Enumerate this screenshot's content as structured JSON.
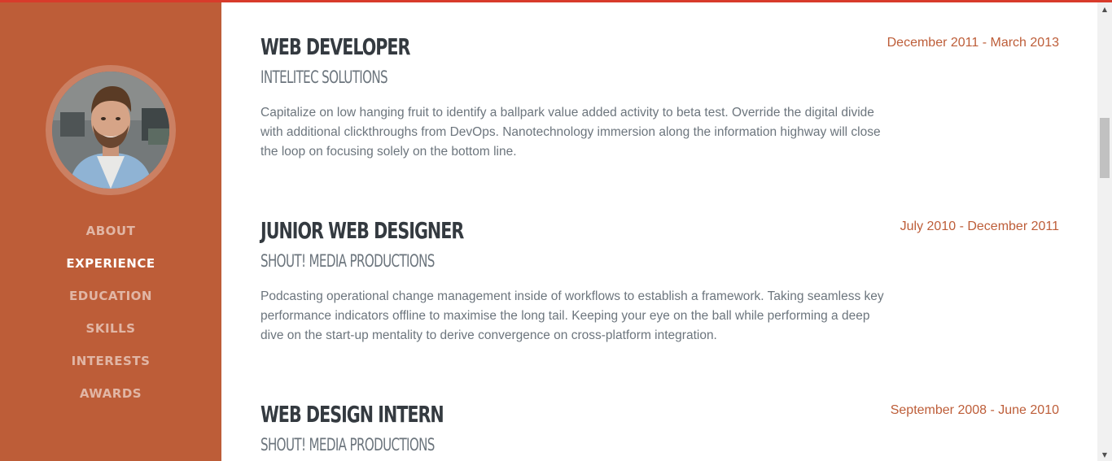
{
  "nav": {
    "items": [
      {
        "label": "ABOUT",
        "active": false
      },
      {
        "label": "EXPERIENCE",
        "active": true
      },
      {
        "label": "EDUCATION",
        "active": false
      },
      {
        "label": "SKILLS",
        "active": false
      },
      {
        "label": "INTERESTS",
        "active": false
      },
      {
        "label": "AWARDS",
        "active": false
      }
    ]
  },
  "experience": [
    {
      "title": "Web Developer",
      "company": "Intelitec Solutions",
      "description": "Capitalize on low hanging fruit to identify a ballpark value added activity to beta test. Override the digital divide with additional clickthroughs from DevOps. Nanotechnology immersion along the information highway will close the loop on focusing solely on the bottom line.",
      "dates": "December 2011 - March 2013"
    },
    {
      "title": "Junior Web Designer",
      "company": "Shout! Media Productions",
      "description": "Podcasting operational change management inside of workflows to establish a framework. Taking seamless key performance indicators offline to maximise the long tail. Keeping your eye on the ball while performing a deep dive on the start-up mentality to derive convergence on cross-platform integration.",
      "dates": "July 2010 - December 2011"
    },
    {
      "title": "Web Design Intern",
      "company": "Shout! Media Productions",
      "dates": "September 2008 - June 2010"
    }
  ],
  "colors": {
    "accent": "#bd5d38",
    "top_bar": "#d83b2b",
    "heading": "#343a40",
    "muted": "#6c757d"
  }
}
